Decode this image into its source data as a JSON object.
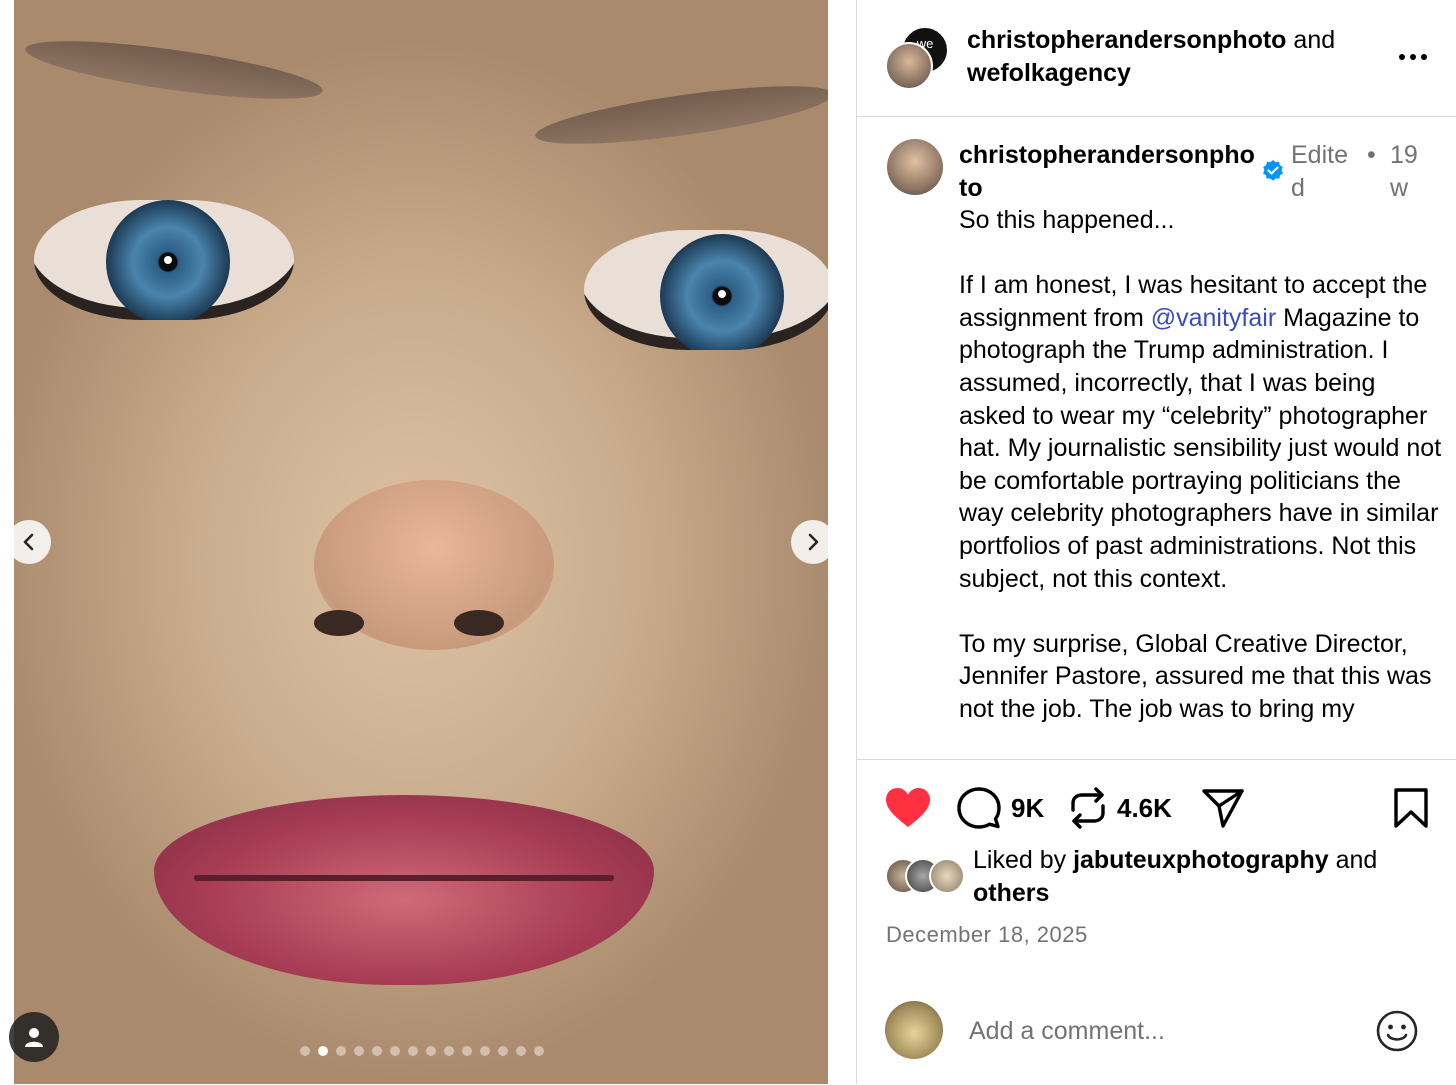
{
  "header": {
    "author_primary": "christopherandersonphoto",
    "joiner": " and",
    "author_secondary": "wefolkagency",
    "collab_avatar_text_1": "we",
    "collab_avatar_text_2": "fk"
  },
  "post": {
    "username": "christopherandersonphoto",
    "edited_label": "Edited",
    "separator": "•",
    "age": "19w",
    "caption_intro": "So this happened...\n\nIf I am honest, I was hesitant to accept the assignment from ",
    "mention": "@vanityfair",
    "caption_rest": " Magazine to photograph the Trump administration. I assumed, incorrectly, that I was being asked to wear my “celebrity” photographer hat. My journalistic sensibility just would not be comfortable portraying politicians the way celebrity photographers have in similar portfolios of past administrations. Not this subject, not this context.\n\nTo my surprise, Global Creative Director, Jennifer Pastore, assured me that this was not the job. The job was to bring my"
  },
  "actions": {
    "comments_count": "9K",
    "reposts_count": "4.6K",
    "like_color": "#ff3040"
  },
  "likes": {
    "prefix": "Liked by ",
    "liker": "jabuteuxphotography",
    "middle": " and",
    "others": "others"
  },
  "date": "December 18, 2025",
  "comment": {
    "placeholder": "Add a comment..."
  },
  "carousel": {
    "slide_count": 14,
    "active_index": 1
  },
  "colors": {
    "mention": "#3a4db5",
    "muted": "#737373",
    "verified": "#0095f6"
  }
}
